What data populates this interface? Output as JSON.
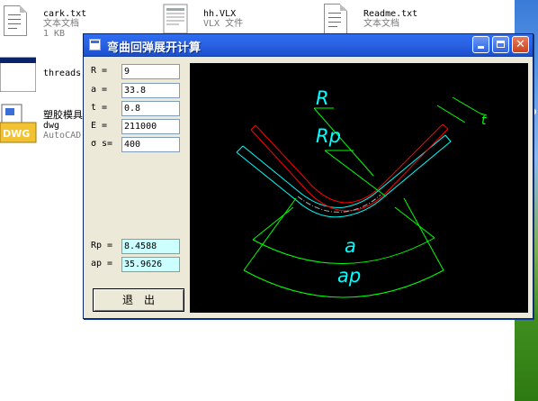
{
  "desktop": {
    "files": [
      {
        "name": "cark.txt",
        "type": "文本文档",
        "size": "1 KB",
        "icon": "text-file-icon"
      },
      {
        "name": "hh.VLX",
        "type": "VLX 文件",
        "icon": "vlx-file-icon"
      },
      {
        "name": "Readme.txt",
        "type": "文本文档",
        "icon": "text-file-icon"
      },
      {
        "name": "threads",
        "icon": "window-icon"
      },
      {
        "name": "塑胶模具",
        "type": "dwg",
        "app": "AutoCAD",
        "icon": "dwg-file-icon",
        "icon_label": "DWG"
      }
    ]
  },
  "dialog": {
    "title": "弯曲回弹展开计算",
    "controls": [
      "minimize-icon",
      "maximize-icon",
      "close-icon"
    ],
    "inputs": [
      {
        "label": "R  =",
        "value": "9"
      },
      {
        "label": "a  =",
        "value": "33.8"
      },
      {
        "label": "t  =",
        "value": "0.8"
      },
      {
        "label": "E  =",
        "value": "211000"
      },
      {
        "label": "σ s=",
        "value": "400"
      }
    ],
    "outputs": [
      {
        "label": "Rp =",
        "value": "8.4588"
      },
      {
        "label": "ap =",
        "value": "35.9626"
      }
    ],
    "exit_label": "退出",
    "diagram": {
      "labels": {
        "R": "R",
        "Rp": "Rp",
        "t": "t",
        "a": "a",
        "ap": "ap"
      },
      "colors": {
        "background": "#000000",
        "original": "#00ffff",
        "springback": "#ff0000",
        "dimension": "#00ff00",
        "label": "#00ffff",
        "center_line": "#b0b0b0"
      }
    }
  }
}
